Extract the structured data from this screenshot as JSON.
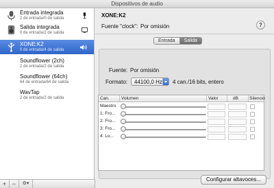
{
  "window": {
    "title": "Dispositivos de audio"
  },
  "devices": [
    {
      "name": "Entrada integrada",
      "sub": "2 de entrada/0 de salida",
      "icon": "microphone-icon",
      "right_icon": "mic-indicator-icon",
      "selected": false
    },
    {
      "name": "Salida integrada",
      "sub": "0 de entrada/2 de salida",
      "icon": "speaker-icon",
      "right_icon": "screen-icon",
      "selected": false
    },
    {
      "name": "XONE:K2",
      "sub": "0 de entrada/4 de salida",
      "icon": "usb-icon",
      "right_icon": "volume-icon",
      "selected": true
    },
    {
      "name": "Soundflower (2ch)",
      "sub": "2 de entrada/2 de salida",
      "icon": "",
      "selected": false
    },
    {
      "name": "Soundflower (64ch)",
      "sub": "64 de entrada/64 de salida",
      "icon": "",
      "selected": false
    },
    {
      "name": "WavTap",
      "sub": "2 de entrada/2 de salida",
      "icon": "",
      "selected": false
    }
  ],
  "footer": {
    "add": "+",
    "remove": "−",
    "gear": "⚙▾"
  },
  "detail": {
    "device_title": "XONE:K2",
    "clock_label": "Fuente \"clock\":",
    "clock_value": "Por omisión",
    "help": "?",
    "tabs": {
      "input": "Entrada",
      "output": "Salida",
      "active": "Salida"
    },
    "source_label": "Fuente:",
    "source_value": "Por omisión",
    "format_label": "Formato:",
    "format_value": "44100,0 Hz",
    "format_desc": "4 can./16 bits, entero",
    "table": {
      "headers": {
        "channel": "Can.",
        "volume": "Volumen",
        "value": "Valor",
        "db": "dB",
        "mute": "Silencio"
      },
      "rows": [
        "Maestro",
        "1: Fro...",
        "2: Fro...",
        "3: Fro...",
        "4: Lo..."
      ]
    },
    "configure_button": "Configurar altavoces..."
  },
  "colors": {
    "selection": "#3b72d1",
    "accent": "#2f66c9"
  }
}
